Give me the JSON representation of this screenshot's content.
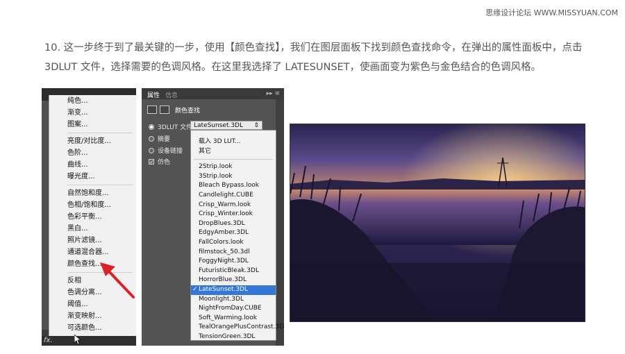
{
  "watermark": "思缘设计论坛 WWW.MISSYUAN.COM",
  "description": {
    "line1": "10. 这一步终于到了最关键的一步，使用【颜色查找】，我们在图层面板下找到颜色查找命令，在弹出的属性面板中，点击",
    "line2": "3DLUT 文件，选择需要的色调风格。在这里我选择了 LATESUNSET，使画面变为紫色与金色结合的色调风格。"
  },
  "adjustment_menu": {
    "groups": [
      [
        "纯色...",
        "渐变...",
        "图案..."
      ],
      [
        "亮度/对比度...",
        "色阶...",
        "曲线...",
        "曝光度..."
      ],
      [
        "自然饱和度...",
        "色相/饱和度...",
        "色彩平衡...",
        "黑白...",
        "照片滤镜...",
        "通道混合器...",
        "颜色查找..."
      ],
      [
        "反相",
        "色调分离...",
        "阈值...",
        "渐变映射...",
        "可选颜色..."
      ]
    ],
    "fx_label": "fx."
  },
  "properties_panel": {
    "tabs": [
      "属性",
      "信息"
    ],
    "title": "颜色查找",
    "options": [
      {
        "label": "3DLUT 文件",
        "type": "radio",
        "checked": true
      },
      {
        "label": "摘要",
        "type": "radio",
        "checked": false
      },
      {
        "label": "设备链接",
        "type": "radio",
        "checked": false
      },
      {
        "label": "仿色",
        "type": "checkbox",
        "checked": true
      }
    ],
    "selected_value": "LateSunset.3DL",
    "dropdown_top": [
      "载入 3D LUT...",
      "其它"
    ],
    "dropdown_items": [
      "2Strip.look",
      "3Strip.look",
      "Bleach Bypass.look",
      "Candlelight.CUBE",
      "Crisp_Warm.look",
      "Crisp_Winter.look",
      "DropBlues.3DL",
      "EdgyAmber.3DL",
      "FallColors.look",
      "filmstock_50.3dl",
      "FoggyNight.3DL",
      "FuturisticBleak.3DL",
      "HorrorBlue.3DL",
      "LateSunset.3DL",
      "Moonlight.3DL",
      "NightFromDay.CUBE",
      "Soft_Warming.look",
      "TealOrangePlusContrast.3DL",
      "TensionGreen.3DL"
    ],
    "checked_index": 13
  },
  "colors": {
    "menu_bg": "#f0f0f0",
    "panel_bg": "#535353",
    "selection": "#3477d6",
    "arrow": "#d8232a"
  }
}
